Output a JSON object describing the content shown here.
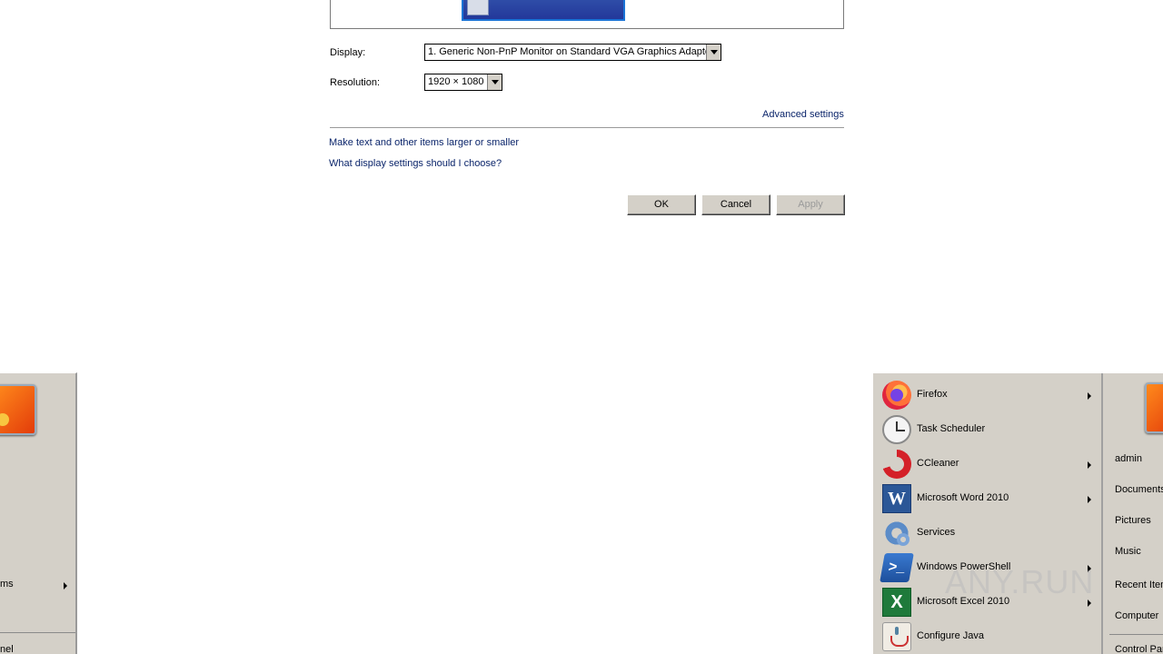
{
  "display_settings": {
    "display_label": "Display:",
    "display_value": "1. Generic Non-PnP Monitor on Standard VGA Graphics Adapter",
    "resolution_label": "Resolution:",
    "resolution_value": "1920 × 1080",
    "advanced_link": "Advanced settings",
    "text_size_link": "Make text and other items larger or smaller",
    "help_link": "What display settings should I choose?",
    "ok_label": "OK",
    "cancel_label": "Cancel",
    "apply_label": "Apply"
  },
  "left_menu": {
    "programs_label": "ms",
    "control_panel_label": "nel"
  },
  "start_menu": {
    "programs": [
      {
        "label": "Firefox",
        "icon": "firefox-icon",
        "has_submenu": true
      },
      {
        "label": "Task Scheduler",
        "icon": "task-scheduler-icon",
        "has_submenu": false
      },
      {
        "label": "CCleaner",
        "icon": "ccleaner-icon",
        "has_submenu": true
      },
      {
        "label": "Microsoft Word 2010",
        "icon": "word-icon",
        "has_submenu": true
      },
      {
        "label": "Services",
        "icon": "services-icon",
        "has_submenu": false
      },
      {
        "label": "Windows PowerShell",
        "icon": "powershell-icon",
        "has_submenu": true
      },
      {
        "label": "Microsoft Excel 2010",
        "icon": "excel-icon",
        "has_submenu": true
      },
      {
        "label": "Configure Java",
        "icon": "java-icon",
        "has_submenu": false
      }
    ],
    "icon_glyphs": {
      "word": "W",
      "excel": "X",
      "powershell": ">_"
    },
    "places": [
      "admin",
      "Documents",
      "Pictures",
      "Music",
      "Recent Items",
      "Computer",
      "Control Panel"
    ]
  },
  "watermark": {
    "text": "ANY.RUN"
  }
}
